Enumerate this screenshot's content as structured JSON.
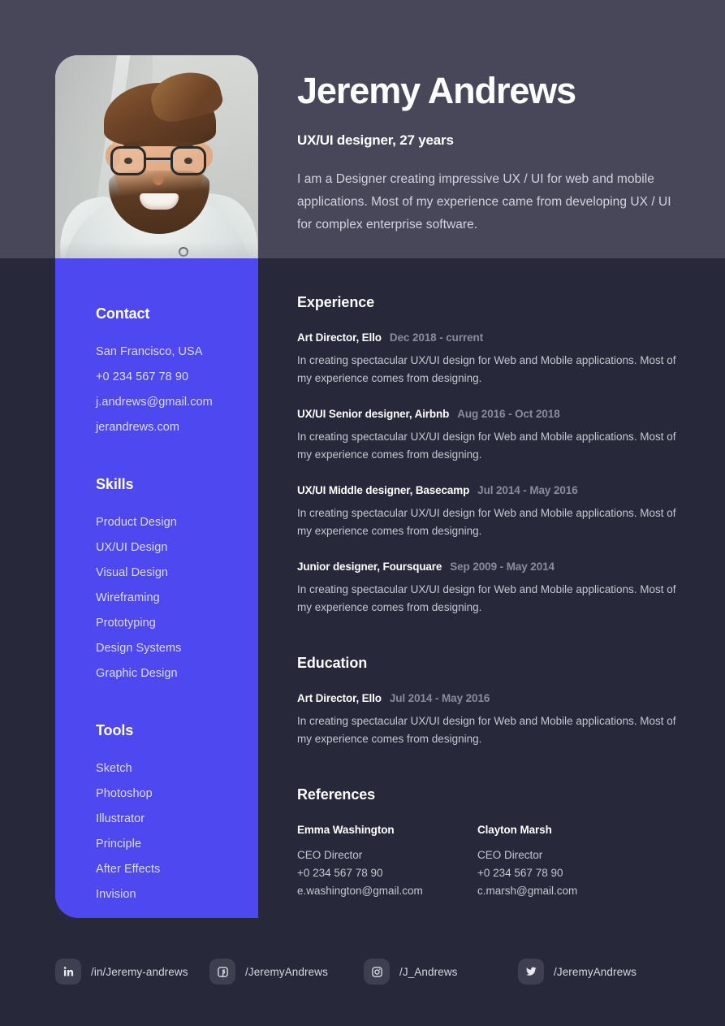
{
  "header": {
    "name": "Jeremy Andrews",
    "role": "UX/UI designer, 27 years",
    "bio": "I am a Designer creating impressive UX / UI for web and mobile applications. Most of my experience came from developing UX / UI for complex enterprise software."
  },
  "sidebar": {
    "contact": {
      "heading": "Contact",
      "items": [
        "San Francisco, USA",
        "+0 234 567 78 90",
        "j.andrews@gmail.com",
        "jerandrews.com"
      ]
    },
    "skills": {
      "heading": "Skills",
      "items": [
        "Product Design",
        "UX/UI Design",
        "Visual Design",
        "Wireframing",
        "Prototyping",
        "Design Systems",
        "Graphic Design"
      ]
    },
    "tools": {
      "heading": "Tools",
      "items": [
        "Sketch",
        "Photoshop",
        "Illustrator",
        "Principle",
        "After Effects",
        "Invision"
      ]
    }
  },
  "experience": {
    "heading": "Experience",
    "entries": [
      {
        "title": "Art Director, Ello",
        "date": "Dec 2018 - current",
        "desc": "In creating spectacular UX/UI design for Web and Mobile applications. Most of my experience comes from designing."
      },
      {
        "title": "UX/UI Senior designer, Airbnb",
        "date": "Aug 2016 - Oct 2018",
        "desc": "In creating spectacular UX/UI design for Web and Mobile applications. Most of my experience comes from designing."
      },
      {
        "title": "UX/UI Middle designer, Basecamp",
        "date": "Jul 2014 - May 2016",
        "desc": "In creating spectacular UX/UI design for Web and Mobile applications. Most of my experience comes from designing."
      },
      {
        "title": "Junior designer, Foursquare",
        "date": "Sep 2009 - May 2014",
        "desc": "In creating spectacular UX/UI design for Web and Mobile applications. Most of my experience comes from designing."
      }
    ]
  },
  "education": {
    "heading": "Education",
    "entries": [
      {
        "title": "Art Director, Ello",
        "date": "Jul 2014 - May 2016",
        "desc": "In creating spectacular UX/UI design for Web and Mobile applications. Most of my experience comes from designing."
      }
    ]
  },
  "references": {
    "heading": "References",
    "people": [
      {
        "name": "Emma Washington",
        "role": "CEO Director",
        "phone": "+0 234 567 78 90",
        "email": "e.washington@gmail.com"
      },
      {
        "name": "Clayton Marsh",
        "role": "CEO Director",
        "phone": "+0 234 567 78 90",
        "email": "c.marsh@gmail.com"
      }
    ]
  },
  "social": [
    {
      "icon": "linkedin-icon",
      "label": "/in/Jeremy-andrews"
    },
    {
      "icon": "facebook-icon",
      "label": "/JeremyAndrews"
    },
    {
      "icon": "instagram-icon",
      "label": "/J_Andrews"
    },
    {
      "icon": "twitter-icon",
      "label": "/JeremyAndrews"
    }
  ],
  "colors": {
    "accent": "#4d48ef",
    "page_bg": "#272839",
    "header_band": "#48475a",
    "muted_text": "#8b8b9e",
    "tile_bg": "#3e3f50"
  }
}
